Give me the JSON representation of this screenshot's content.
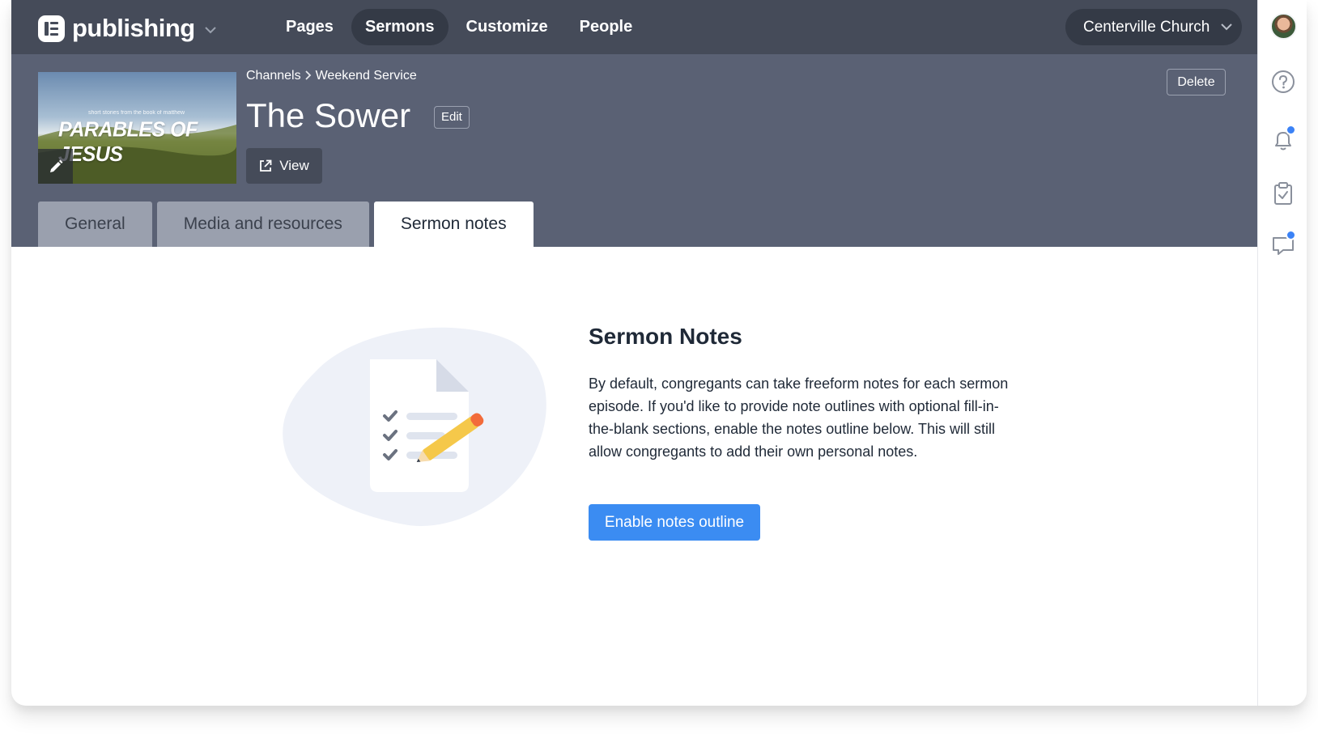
{
  "app": {
    "name": "publishing",
    "icons": {
      "logo": "publishing-logo-icon",
      "caret": "chevron-down-icon"
    }
  },
  "nav": {
    "links": [
      {
        "label": "Pages",
        "active": false
      },
      {
        "label": "Sermons",
        "active": true
      },
      {
        "label": "Customize",
        "active": false
      },
      {
        "label": "People",
        "active": false
      }
    ],
    "org": "Centerville Church"
  },
  "header": {
    "thumbnail": {
      "subtitle": "short stories from the book of matthew",
      "title": "PARABLES OF JESUS"
    },
    "breadcrumb": [
      "Channels",
      "Weekend Service"
    ],
    "title": "The Sower",
    "edit_label": "Edit",
    "view_label": "View",
    "delete_label": "Delete"
  },
  "tabs": [
    {
      "label": "General",
      "active": false
    },
    {
      "label": "Media and resources",
      "active": false
    },
    {
      "label": "Sermon notes",
      "active": true
    }
  ],
  "main": {
    "heading": "Sermon Notes",
    "body": "By default, congregants can take freeform notes for each sermon episode. If you'd like to provide note outlines with optional fill-in-the-blank sections, enable the notes outline below. This will still allow congregants to add their own personal notes.",
    "button": "Enable notes outline"
  },
  "rail": {
    "icons": [
      "avatar",
      "help-icon",
      "bell-icon",
      "clipboard-check-icon",
      "chat-icon"
    ],
    "badges": {
      "notifications": true,
      "chat": true
    }
  },
  "colors": {
    "nav_bg": "#454b59",
    "header_bg": "#5a6174",
    "accent": "#3b8cf2",
    "badge": "#3b82f6"
  }
}
